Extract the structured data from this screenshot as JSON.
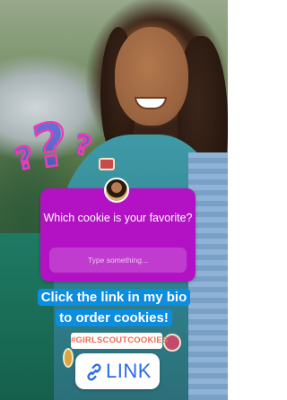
{
  "question_sticker": {
    "question": "Which cookie is your favorite?",
    "input_placeholder": "Type something..."
  },
  "caption": {
    "line1": "Click the link in my bio",
    "line2": "to order cookies!"
  },
  "hashtag": "#GIRLSCOUTCOOKIES",
  "link_sticker": {
    "label": "LINK",
    "icon": "link-icon"
  },
  "colors": {
    "question_sticker_bg": "#b312c4",
    "caption_bg": "#0b8de1",
    "hashtag_text": "#f06a4d",
    "link_text": "#2b6be6",
    "question_marks": "#e83fae"
  }
}
